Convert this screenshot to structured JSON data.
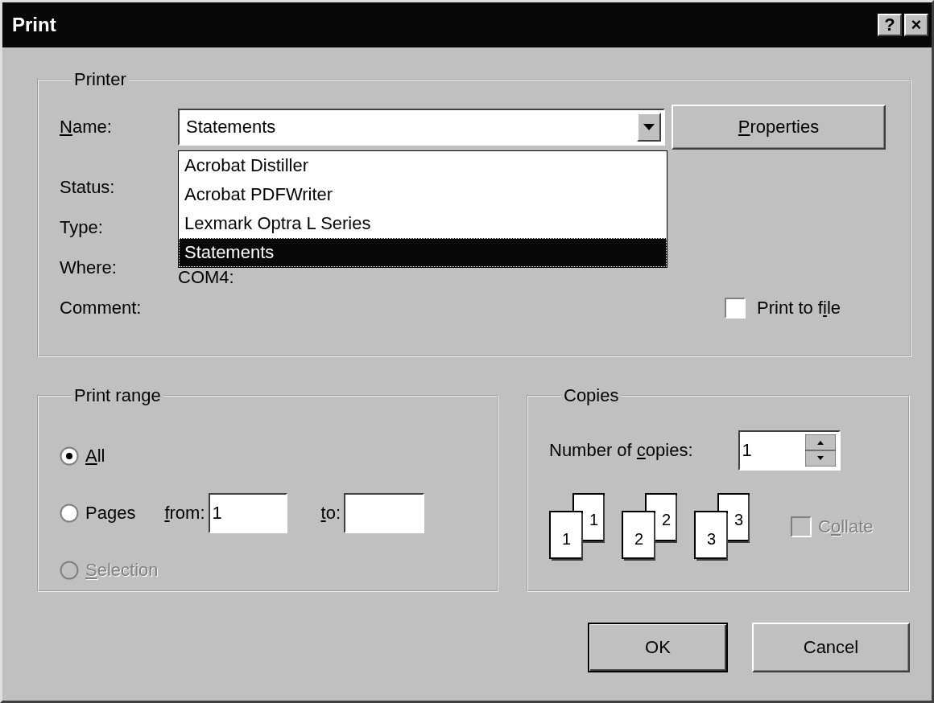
{
  "window": {
    "title": "Print",
    "title_buttons": [
      "?",
      "×"
    ]
  },
  "printer": {
    "legend": "Printer",
    "name_label": {
      "u": "N",
      "post": "ame:"
    },
    "name_value": "Statements",
    "dropdown_items": [
      {
        "label": "Acrobat Distiller",
        "selected": false
      },
      {
        "label": "Acrobat PDFWriter",
        "selected": false
      },
      {
        "label": "Lexmark Optra L Series",
        "selected": false
      },
      {
        "label": "Statements",
        "selected": true
      }
    ],
    "properties_button": {
      "u": "P",
      "post": "roperties"
    },
    "info": [
      {
        "label": "Status:"
      },
      {
        "label": "Type:"
      },
      {
        "label": "Where:",
        "value": "COM4:"
      },
      {
        "label": "Comment:"
      }
    ],
    "print_to_file": {
      "label": {
        "pre": "Print to f",
        "u": "i",
        "post": "le"
      },
      "checked": false
    }
  },
  "print_range": {
    "legend": "Print range",
    "options": [
      {
        "label": {
          "u": "A",
          "post": "ll"
        },
        "selected": true,
        "disabled": false
      },
      {
        "label": {
          "post": "Pages"
        },
        "selected": false,
        "disabled": false
      },
      {
        "label": {
          "u": "S",
          "post": "election"
        },
        "selected": false,
        "disabled": true
      }
    ],
    "from_label": {
      "u": "f",
      "post": "rom:"
    },
    "from_value": "1",
    "to_label": {
      "u": "t",
      "post": "o:"
    }
  },
  "copies": {
    "legend": "Copies",
    "number_label": {
      "pre": "Number of ",
      "u": "c",
      "post": "opies:"
    },
    "number_value": "1",
    "collate_pages": [
      {
        "front": "1",
        "back": "1"
      },
      {
        "front": "2",
        "back": "2"
      },
      {
        "front": "3",
        "back": "3"
      }
    ],
    "collate": {
      "label": {
        "pre": "C",
        "u": "o",
        "post": "llate"
      },
      "checked": false,
      "disabled": true
    }
  },
  "buttons": [
    {
      "label": "OK",
      "default": true
    },
    {
      "label": "Cancel",
      "default": false
    }
  ]
}
